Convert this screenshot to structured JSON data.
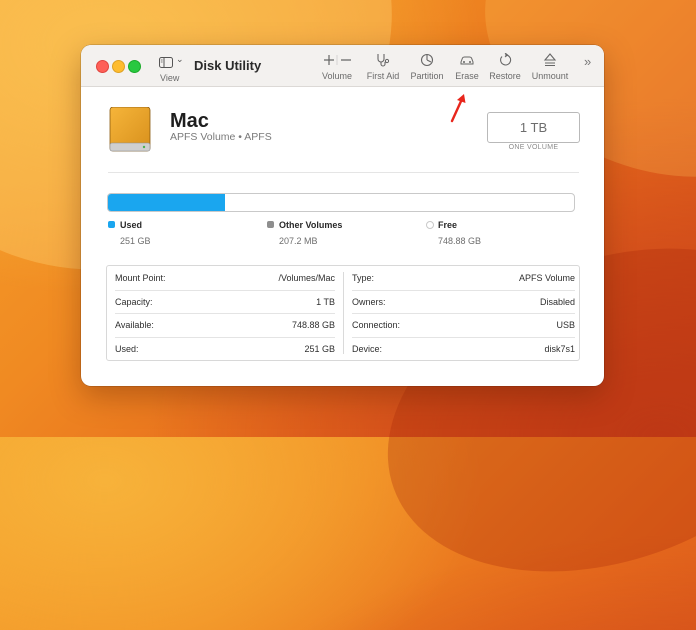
{
  "app": {
    "title": "Disk Utility"
  },
  "toolbar": {
    "view_label": "View",
    "items": [
      {
        "label": "Volume",
        "icon": "plus-minus-icon"
      },
      {
        "label": "First Aid",
        "icon": "stethoscope-icon"
      },
      {
        "label": "Partition",
        "icon": "pie-partition-icon"
      },
      {
        "label": "Erase",
        "icon": "car-erase-icon"
      },
      {
        "label": "Restore",
        "icon": "restore-arrow-icon"
      },
      {
        "label": "Unmount",
        "icon": "eject-icon"
      }
    ],
    "more_icon": "chevron-double-right-icon"
  },
  "volume": {
    "name": "Mac",
    "subtitle": "APFS Volume • APFS",
    "capacity": "1 TB",
    "capacity_label": "ONE VOLUME",
    "icon": "external-drive-icon"
  },
  "usage": {
    "used_fraction": 0.251,
    "legend": [
      {
        "name": "Used",
        "value": "251 GB",
        "color": "#1aa6ef"
      },
      {
        "name": "Other Volumes",
        "value": "207.2 MB",
        "color": "#8e8e8e"
      },
      {
        "name": "Free",
        "value": "748.88 GB",
        "color": "#ffffff"
      }
    ]
  },
  "info": {
    "left": [
      {
        "key": "Mount Point:",
        "value": "/Volumes/Mac"
      },
      {
        "key": "Capacity:",
        "value": "1 TB"
      },
      {
        "key": "Available:",
        "value": "748.88 GB"
      },
      {
        "key": "Used:",
        "value": "251 GB"
      }
    ],
    "right": [
      {
        "key": "Type:",
        "value": "APFS Volume"
      },
      {
        "key": "Owners:",
        "value": "Disabled"
      },
      {
        "key": "Connection:",
        "value": "USB"
      },
      {
        "key": "Device:",
        "value": "disk7s1"
      }
    ]
  },
  "colors": {
    "accent": "#1aa6ef",
    "annotation_arrow": "#e8261c"
  }
}
